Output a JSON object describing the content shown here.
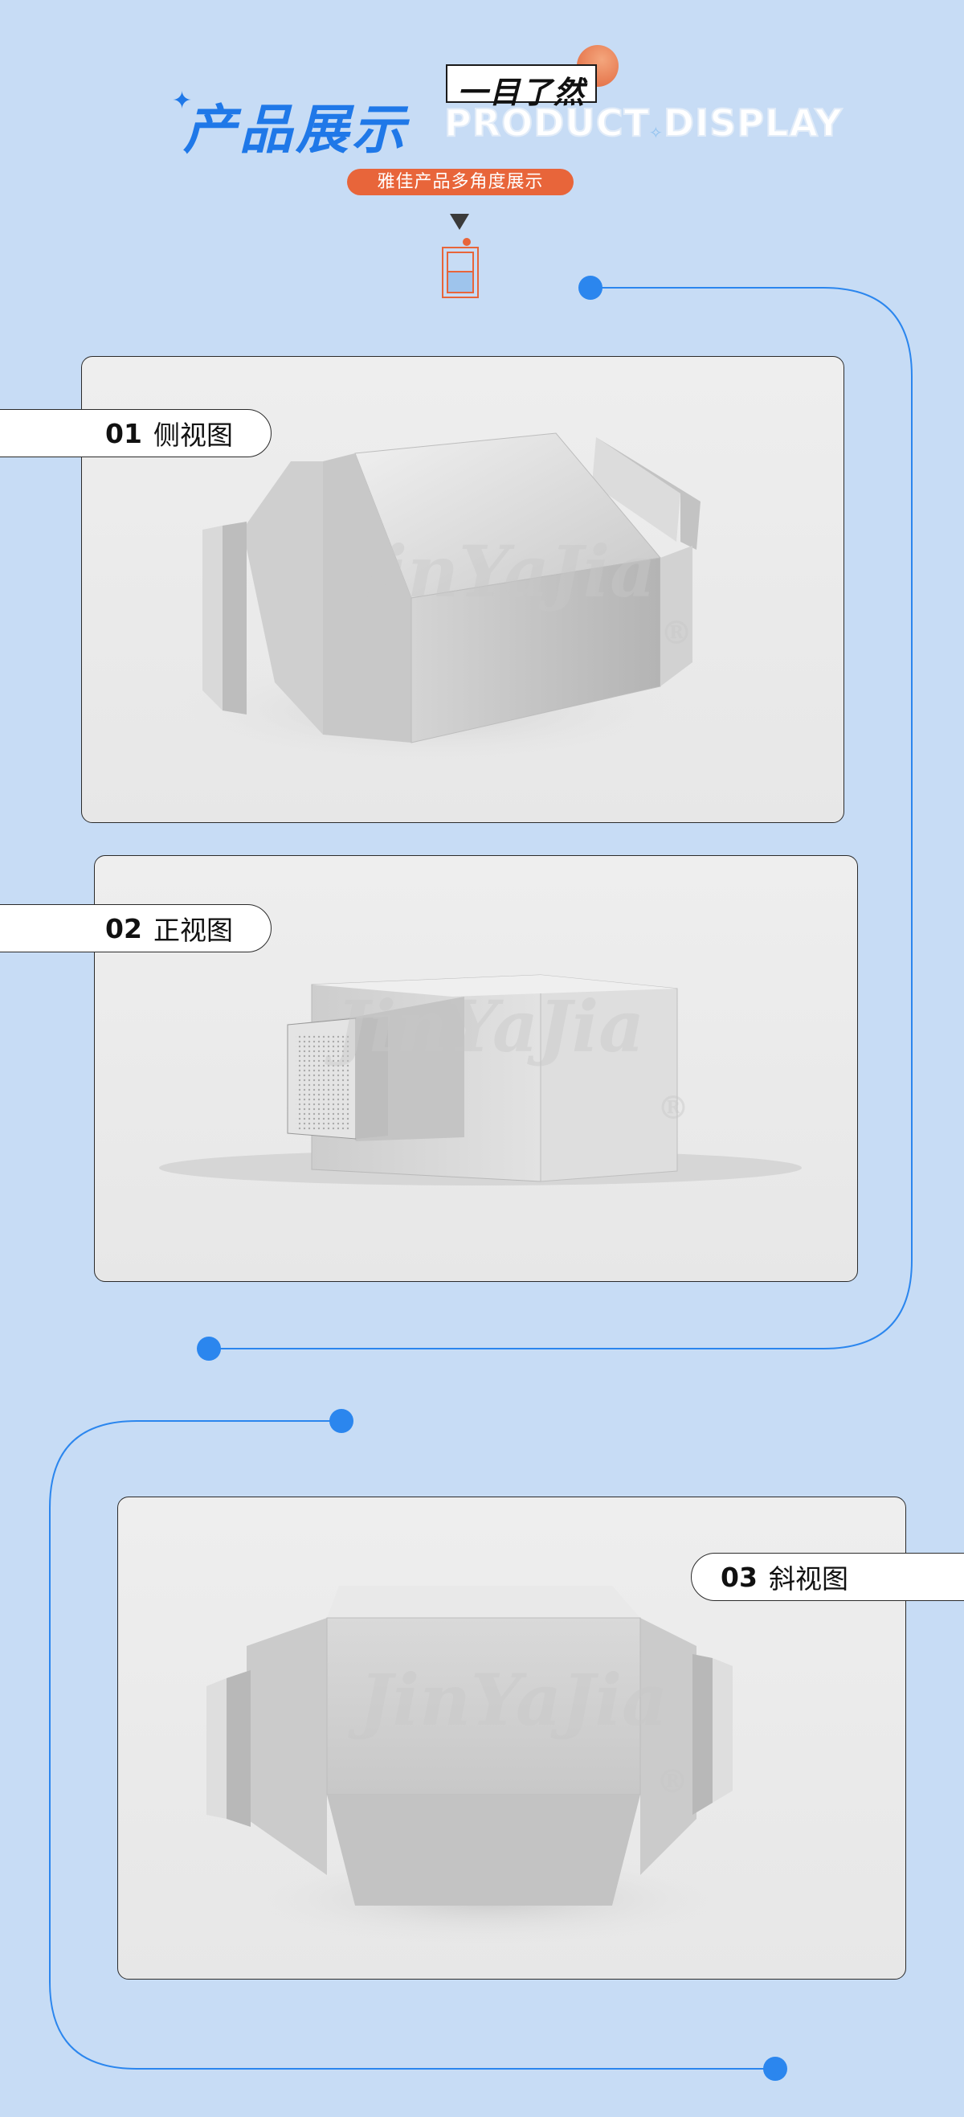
{
  "header": {
    "title_cn": "产品展示",
    "title_en": "PRODUCT DISPLAY",
    "tag": "一目了然",
    "subtitle": "雅佳产品多角度展示"
  },
  "views": [
    {
      "number": "01",
      "label": "侧视图"
    },
    {
      "number": "02",
      "label": "正视图"
    },
    {
      "number": "03",
      "label": "斜视图"
    }
  ],
  "watermark": "JinYaJia",
  "watermark_mark": "®",
  "colors": {
    "background": "#c7dcf5",
    "accent_blue": "#1f78e8",
    "accent_orange": "#e8653a",
    "line_blue": "#2b86ee"
  }
}
